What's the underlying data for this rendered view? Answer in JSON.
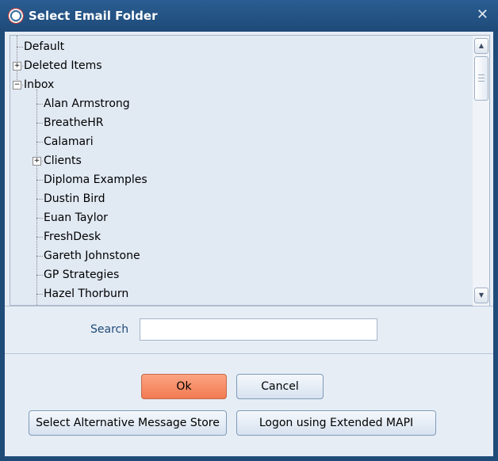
{
  "window": {
    "title": "Select Email Folder",
    "close_glyph": "✕",
    "app_icon": "app-icon"
  },
  "tree": {
    "items": [
      {
        "label": "Default",
        "level": 0,
        "expander": ""
      },
      {
        "label": "Deleted Items",
        "level": 0,
        "expander": "+"
      },
      {
        "label": "Inbox",
        "level": 0,
        "expander": "−"
      },
      {
        "label": "Alan Armstrong",
        "level": 1,
        "expander": ""
      },
      {
        "label": "BreatheHR",
        "level": 1,
        "expander": ""
      },
      {
        "label": "Calamari",
        "level": 1,
        "expander": ""
      },
      {
        "label": "Clients",
        "level": 1,
        "expander": "+"
      },
      {
        "label": "Diploma Examples",
        "level": 1,
        "expander": ""
      },
      {
        "label": "Dustin Bird",
        "level": 1,
        "expander": ""
      },
      {
        "label": "Euan Taylor",
        "level": 1,
        "expander": ""
      },
      {
        "label": "FreshDesk",
        "level": 1,
        "expander": ""
      },
      {
        "label": "Gareth Johnstone",
        "level": 1,
        "expander": ""
      },
      {
        "label": "GP Strategies",
        "level": 1,
        "expander": ""
      },
      {
        "label": "Hazel Thorburn",
        "level": 1,
        "expander": ""
      }
    ]
  },
  "scrollbar": {
    "up_glyph": "▲",
    "down_glyph": "▼"
  },
  "search": {
    "label": "Search",
    "value": "",
    "placeholder": ""
  },
  "buttons": {
    "ok": "Ok",
    "cancel": "Cancel",
    "select_store": "Select Alternative Message Store",
    "logon_mapi": "Logon using Extended MAPI"
  },
  "colors": {
    "title_bar": "#1f4b78",
    "ok_button": "#f27a52",
    "tree_bg": "#e1e9f3"
  }
}
